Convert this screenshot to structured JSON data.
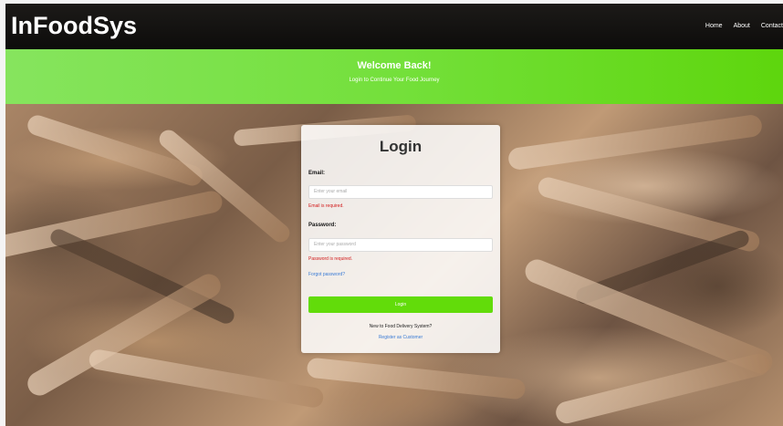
{
  "navbar": {
    "brand": "InFoodSys",
    "links": [
      "Home",
      "About",
      "Contact"
    ]
  },
  "banner": {
    "title": "Welcome Back!",
    "subtitle": "Login to Continue Your Food Journey"
  },
  "login_card": {
    "title": "Login",
    "email_label": "Email:",
    "email_placeholder": "Enter your email",
    "email_error": "Email is required.",
    "password_label": "Password:",
    "password_placeholder": "Enter your password",
    "password_error": "Password is required.",
    "forgot_link": "Forgot password?",
    "submit_label": "Login",
    "register_prompt": "New to Food Delivery System?",
    "register_link": "Register as Customer"
  },
  "colors": {
    "navbar": "#1c1a18",
    "banner": "#74e03b",
    "button": "#62dc0a",
    "error": "#d21a1a",
    "link": "#3a7bd5"
  }
}
